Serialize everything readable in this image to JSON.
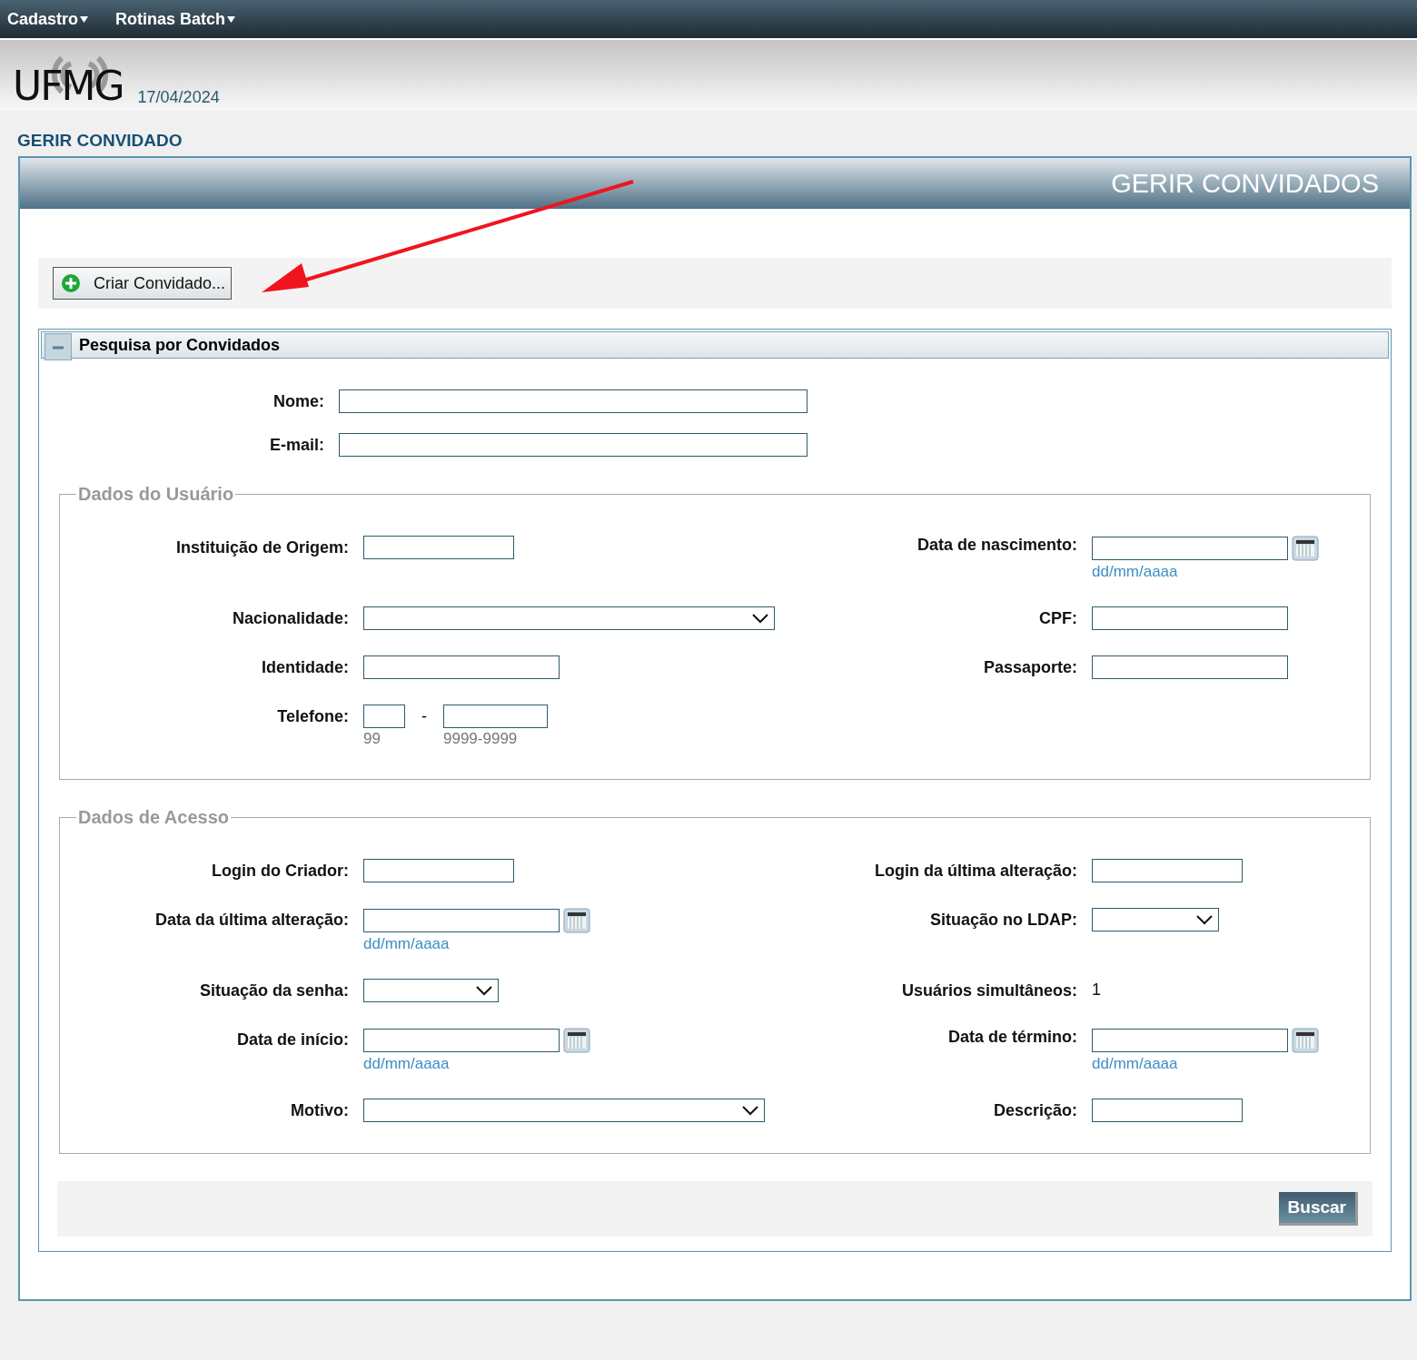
{
  "menu": [
    {
      "label": "Cadastro"
    },
    {
      "label": "Rotinas Batch"
    }
  ],
  "header": {
    "logo": "UFMG",
    "date": "17/04/2024"
  },
  "page_title": "GERIR CONVIDADO",
  "panel": {
    "title": "GERIR CONVIDADOS",
    "create_button": "Criar Convidado...",
    "search": {
      "title": "Pesquisa por Convidados",
      "expanded": true,
      "top_fields": [
        {
          "label": "Nome:"
        },
        {
          "label": "E-mail:"
        }
      ],
      "fieldsets": [
        {
          "legend": "Dados do Usuário",
          "rows": [
            {
              "left": {
                "label": "Instituição de Origem:",
                "kind": "text"
              },
              "right": {
                "label": "Data de nascimento:",
                "kind": "date",
                "hint": "dd/mm/aaaa"
              }
            },
            {
              "left": {
                "label": "Nacionalidade:",
                "kind": "select"
              },
              "right": {
                "label": "CPF:",
                "kind": "text"
              }
            },
            {
              "left": {
                "label": "Identidade:",
                "kind": "text"
              },
              "right": {
                "label": "Passaporte:",
                "kind": "text"
              }
            },
            {
              "left": {
                "label": "Telefone:",
                "kind": "phone",
                "separator": "-",
                "hints": [
                  "99",
                  "9999-9999"
                ]
              }
            }
          ]
        },
        {
          "legend": "Dados de Acesso",
          "rows": [
            {
              "left": {
                "label": "Login do Criador:",
                "kind": "text"
              },
              "right": {
                "label": "Login da última alteração:",
                "kind": "text"
              }
            },
            {
              "left": {
                "label": "Data da última alteração:",
                "kind": "date",
                "hint": "dd/mm/aaaa"
              },
              "right": {
                "label": "Situação no LDAP:",
                "kind": "select"
              }
            },
            {
              "left": {
                "label": "Situação da senha:",
                "kind": "select"
              },
              "right": {
                "label": "Usuários simultâneos:",
                "kind": "static",
                "value": "1"
              }
            },
            {
              "left": {
                "label": "Data de início:",
                "kind": "date",
                "hint": "dd/mm/aaaa"
              },
              "right": {
                "label": "Data de término:",
                "kind": "date",
                "hint": "dd/mm/aaaa"
              }
            },
            {
              "left": {
                "label": "Motivo:",
                "kind": "select"
              },
              "right": {
                "label": "Descrição:",
                "kind": "text"
              }
            }
          ]
        }
      ],
      "submit_button": "Buscar"
    }
  }
}
